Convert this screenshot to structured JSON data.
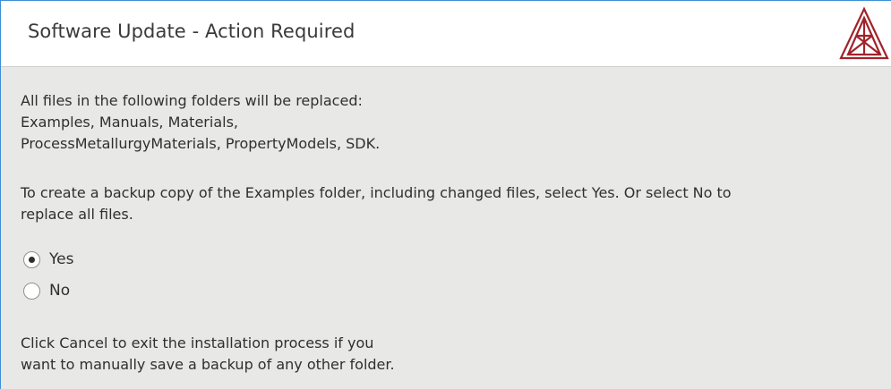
{
  "header": {
    "title": "Software Update - Action Required",
    "logo_icon": "triangle-logo-icon",
    "logo_color": "#a0232a"
  },
  "content": {
    "para1_lines": [
      "All files in the following folders will be replaced:",
      "Examples, Manuals, Materials,",
      "ProcessMetallurgyMaterials, PropertyModels, SDK."
    ],
    "para2_lines": [
      "To create a backup copy of the Examples folder, including changed files, select Yes. Or select No to",
      "replace all files."
    ],
    "options": [
      {
        "label": "Yes",
        "selected": true
      },
      {
        "label": "No",
        "selected": false
      }
    ],
    "para3_lines": [
      "Click Cancel to exit the installation process if you",
      "want to manually save a backup of any other folder."
    ]
  },
  "colors": {
    "header_bg": "#ffffff",
    "body_bg": "#e8e8e7",
    "window_border": "#3d8fd6"
  }
}
